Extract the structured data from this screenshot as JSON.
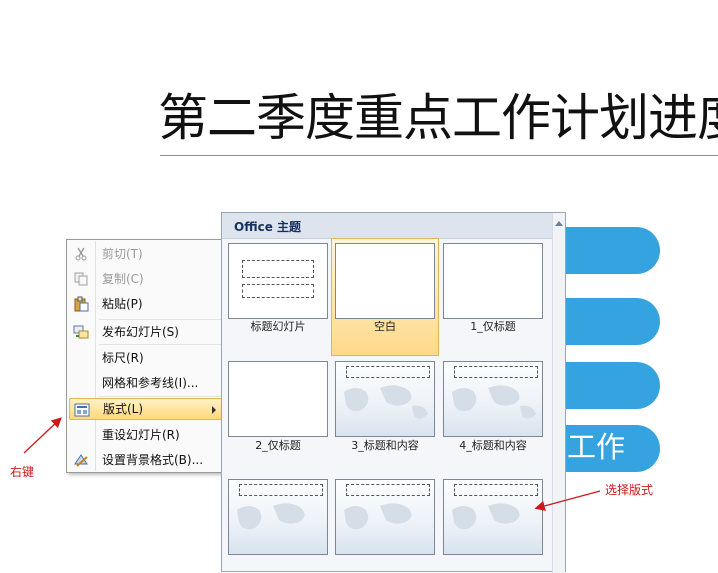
{
  "slide": {
    "title": "第二季度重点工作计划进度",
    "pill_text": "工作"
  },
  "context_menu": {
    "items": [
      {
        "label": "剪切(T)",
        "icon": "scissors-icon",
        "disabled": true
      },
      {
        "label": "复制(C)",
        "icon": "copy-icon",
        "disabled": true
      },
      {
        "label": "粘贴(P)",
        "icon": "paste-icon",
        "disabled": false
      },
      {
        "label": "发布幻灯片(S)",
        "icon": "publish-slides-icon",
        "disabled": false
      },
      {
        "label": "标尺(R)",
        "icon": "",
        "disabled": false
      },
      {
        "label": "网格和参考线(I)...",
        "icon": "",
        "disabled": false
      },
      {
        "label": "版式(L)",
        "icon": "layout-icon",
        "disabled": false,
        "highlighted": true,
        "has_submenu": true
      },
      {
        "label": "重设幻灯片(R)",
        "icon": "",
        "disabled": false
      },
      {
        "label": "设置背景格式(B)...",
        "icon": "format-background-icon",
        "disabled": false
      }
    ]
  },
  "layout_gallery": {
    "header": "Office 主题",
    "layouts": [
      {
        "label": "标题幻灯片",
        "style": "title"
      },
      {
        "label": "空白",
        "style": "blank",
        "selected": true
      },
      {
        "label": "1_仅标题",
        "style": "blank"
      },
      {
        "label": "2_仅标题",
        "style": "blank"
      },
      {
        "label": "3_标题和内容",
        "style": "map"
      },
      {
        "label": "4_标题和内容",
        "style": "map"
      },
      {
        "label": "",
        "style": "map"
      },
      {
        "label": "",
        "style": "map"
      },
      {
        "label": "",
        "style": "map"
      }
    ]
  },
  "annotations": {
    "right_click_label": "右键",
    "choose_layout_label": "选择版式",
    "color": "#cc1a1a"
  },
  "colors": {
    "pill": "#36a3e1",
    "highlight": "#ffd978"
  }
}
